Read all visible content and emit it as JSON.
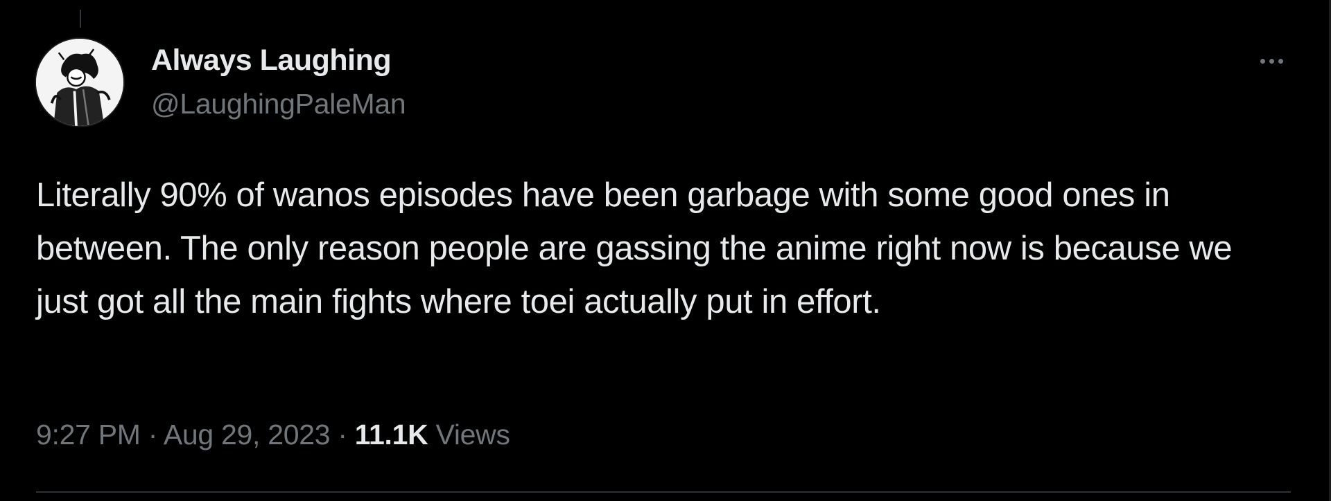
{
  "tweet": {
    "author": {
      "display_name": "Always Laughing",
      "handle": "@LaughingPaleMan",
      "avatar_icon": "profile-avatar-icon"
    },
    "more_icon": "more-options-icon",
    "text": "Literally 90% of wanos episodes have been garbage with some good ones in between. The only reason people are gassing the anime right now is because we just got all the main fights where toei actually put in effort.",
    "meta": {
      "time": "9:27 PM",
      "separator": "·",
      "date": "Aug 29, 2023",
      "views_count": "11.1K",
      "views_label": "Views"
    }
  },
  "colors": {
    "background": "#000000",
    "primary_text": "#e7e9ea",
    "secondary_text": "#71767b",
    "divider": "#2f3336"
  }
}
